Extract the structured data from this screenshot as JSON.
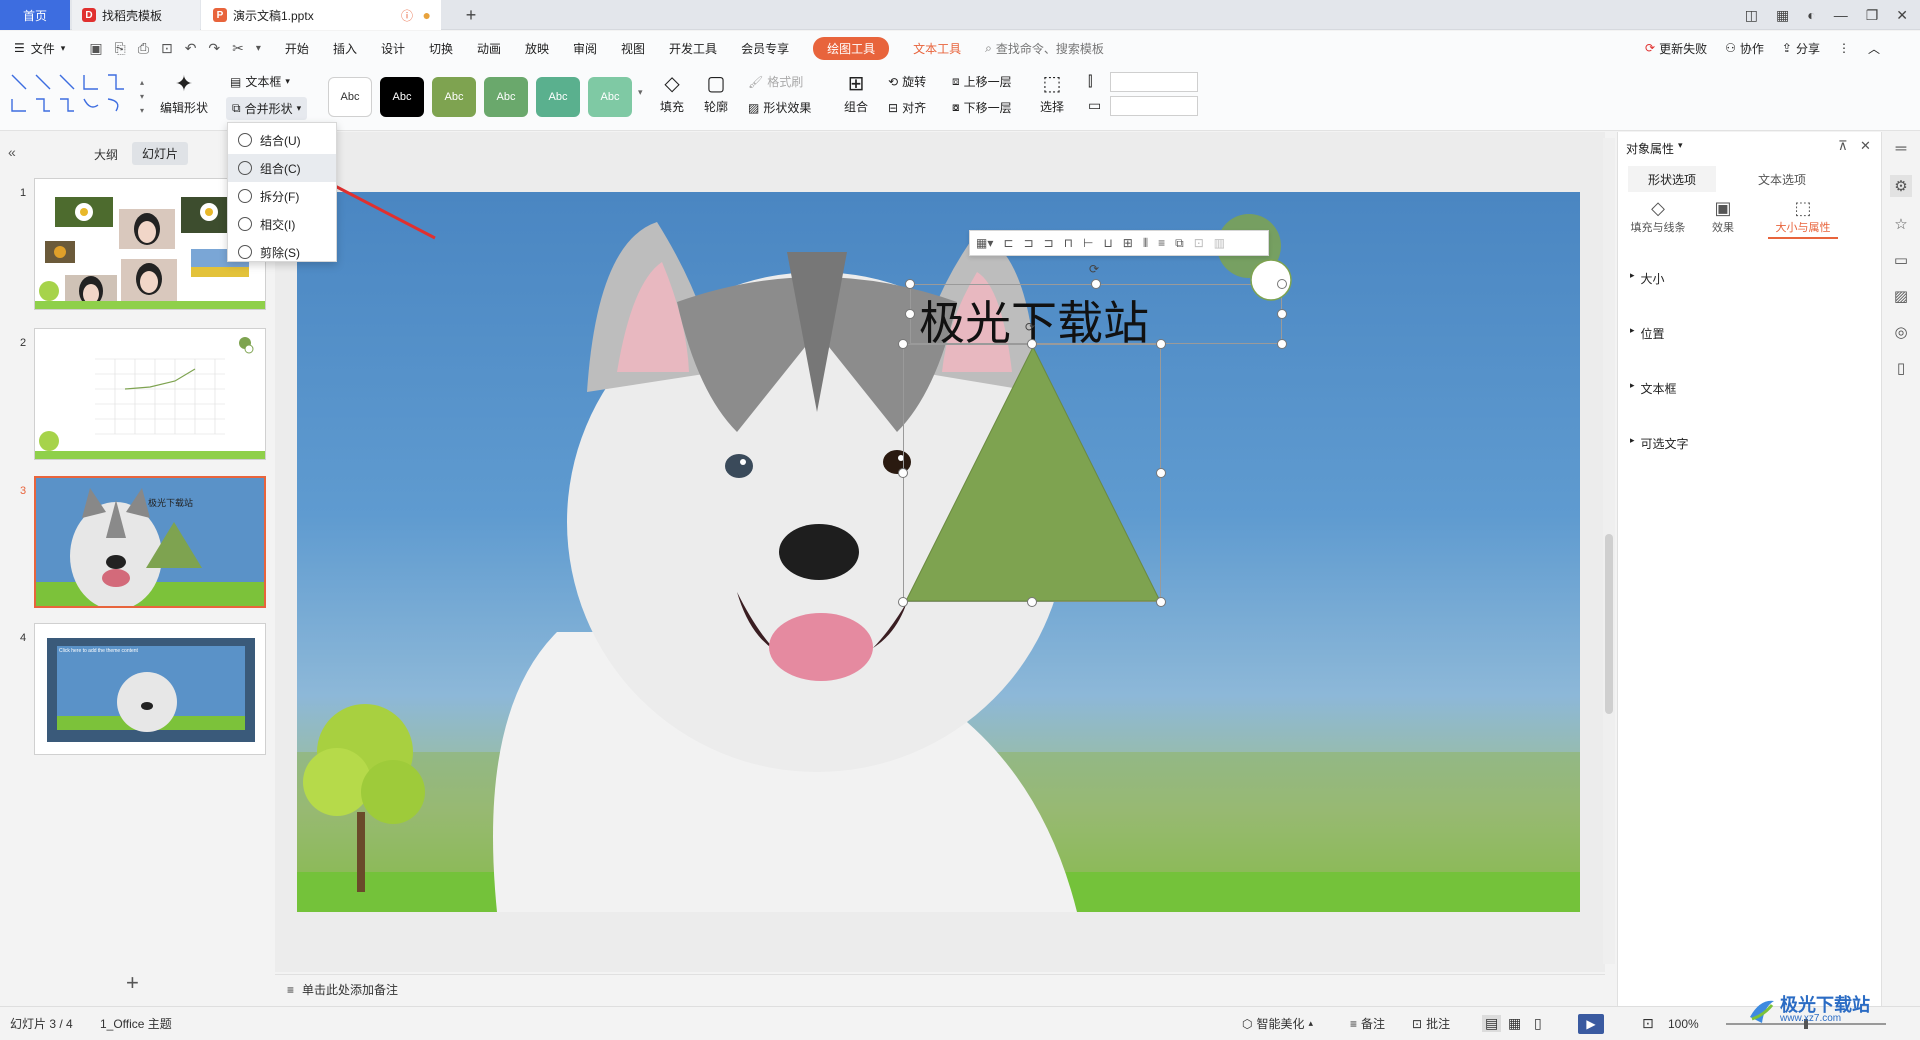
{
  "tabs": {
    "home": "首页",
    "template": "找稻壳模板",
    "document": "演示文稿1.pptx",
    "new_tab": "+"
  },
  "menubar": {
    "file": "文件",
    "items": [
      "开始",
      "插入",
      "设计",
      "切换",
      "动画",
      "放映",
      "审阅",
      "视图",
      "开发工具",
      "会员专享"
    ],
    "drawing_tools": "绘图工具",
    "text_tools": "文本工具",
    "search_placeholder": "查找命令、搜索模板",
    "update_failed": "更新失败",
    "collaborate": "协作",
    "share": "分享"
  },
  "ribbon": {
    "edit_shape": "编辑形状",
    "textbox": "文本框",
    "merge_shape": "合并形状",
    "style_label": "Abc",
    "format_painter": "格式刷",
    "fill": "填充",
    "outline": "轮廓",
    "shape_effect": "形状效果",
    "group": "组合",
    "rotate": "旋转",
    "align": "对齐",
    "bring_forward": "上移一层",
    "send_backward": "下移一层",
    "select": "选择"
  },
  "dropdown": {
    "items": [
      "结合(U)",
      "组合(C)",
      "拆分(F)",
      "相交(I)",
      "剪除(S)"
    ]
  },
  "leftpanel": {
    "outline_tab": "大纲",
    "slides_tab": "幻灯片",
    "slide_numbers": [
      "1",
      "2",
      "3",
      "4"
    ],
    "thumb3_text": "极光下载站",
    "thumb4_text": "Click here to add the theme content",
    "add_slide": "+"
  },
  "slide": {
    "title_text": "极光下载站"
  },
  "notes": {
    "placeholder": "单击此处添加备注"
  },
  "rightpanel": {
    "title": "对象属性",
    "tab_shape": "形状选项",
    "tab_text": "文本选项",
    "sub_fill": "填充与线条",
    "sub_effect": "效果",
    "sub_size": "大小与属性",
    "sections": [
      "大小",
      "位置",
      "文本框",
      "可选文字"
    ]
  },
  "statusbar": {
    "slide_info": "幻灯片 3 / 4",
    "theme": "1_Office 主题",
    "smart_beautify": "智能美化",
    "notes": "备注",
    "comments": "批注",
    "zoom": "100%",
    "watermark": "极光下载站",
    "watermark_url": "www.xz7.com"
  },
  "colors": {
    "accent": "#e8643c",
    "shape_green": "#7ea350",
    "sky_blue": "#4a86c2"
  }
}
